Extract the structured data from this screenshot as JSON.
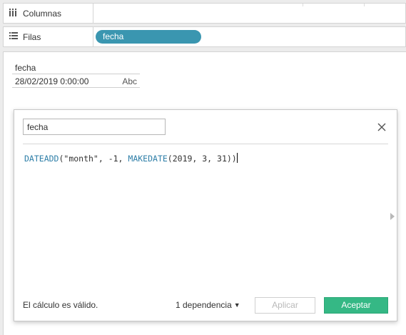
{
  "columns_shelf": {
    "label": "Columnas",
    "icon": "columns-icon",
    "pills": []
  },
  "rows_shelf": {
    "label": "Filas",
    "icon": "rows-list-icon",
    "pills": [
      "fecha"
    ]
  },
  "view": {
    "field_header": "fecha",
    "field_value": "28/02/2019 0:00:00",
    "field_type": "Abc"
  },
  "calc_dialog": {
    "name": "fecha",
    "formula": {
      "fn1": "DATEADD",
      "part1": "(\"month\", -1, ",
      "fn2": "MAKEDATE",
      "part2": "(2019, 3, 31))"
    },
    "status": "El cálculo es válido.",
    "dependencies": "1 dependencia",
    "apply_label": "Aplicar",
    "ok_label": "Aceptar"
  },
  "colors": {
    "pill": "#3a96b0",
    "accept_button": "#35b885",
    "function_text": "#2f7fa8"
  }
}
